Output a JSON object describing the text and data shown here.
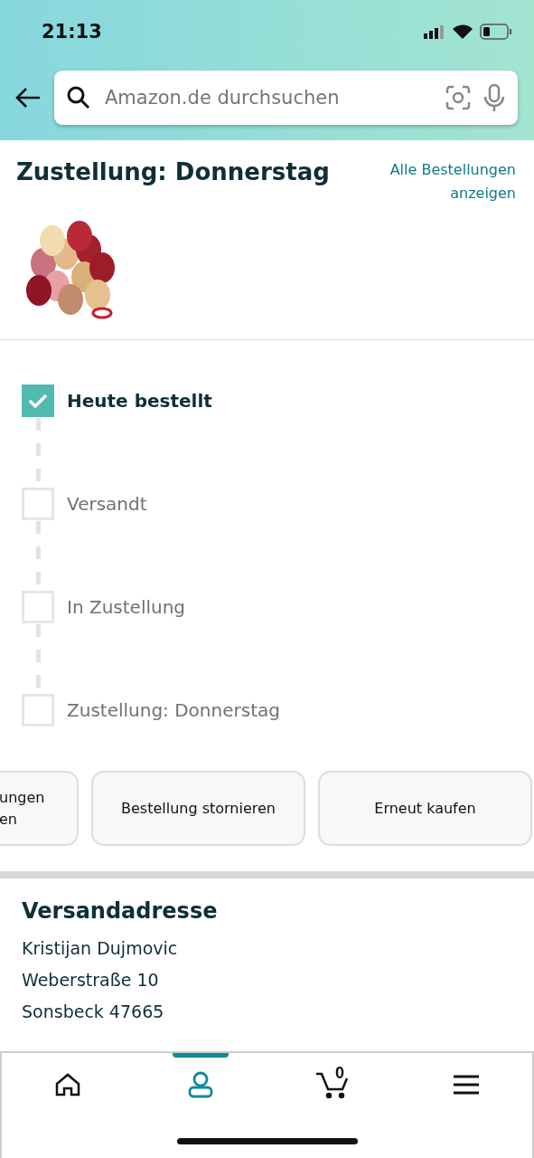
{
  "status_bar": {
    "time": "21:13"
  },
  "search": {
    "placeholder": "Amazon.de durchsuchen"
  },
  "order": {
    "title": "Zustellung: Donnerstag",
    "link": "Alle Bestellungen anzeigen"
  },
  "tracker": [
    {
      "label": "Heute bestellt",
      "checked": true
    },
    {
      "label": "Versandt",
      "checked": false
    },
    {
      "label": "In Zustellung",
      "checked": false
    },
    {
      "label": "Zustellung: Donnerstag",
      "checked": false
    }
  ],
  "actions": [
    {
      "lines": [
        "ungen",
        "en"
      ],
      "cut": true
    },
    {
      "lines": [
        "Bestellung stornieren"
      ],
      "cut": false
    },
    {
      "lines": [
        "Erneut kaufen"
      ],
      "cut": false
    }
  ],
  "address": {
    "heading": "Versandadresse",
    "lines": [
      "Kristijan Dujmovic",
      "Weberstraße 10",
      "Sonsbeck 47665"
    ]
  },
  "nav": [
    {
      "kind": "home",
      "selected": false
    },
    {
      "kind": "account",
      "selected": true
    },
    {
      "kind": "cart",
      "count": "0",
      "selected": false
    },
    {
      "kind": "menu",
      "selected": false
    }
  ]
}
